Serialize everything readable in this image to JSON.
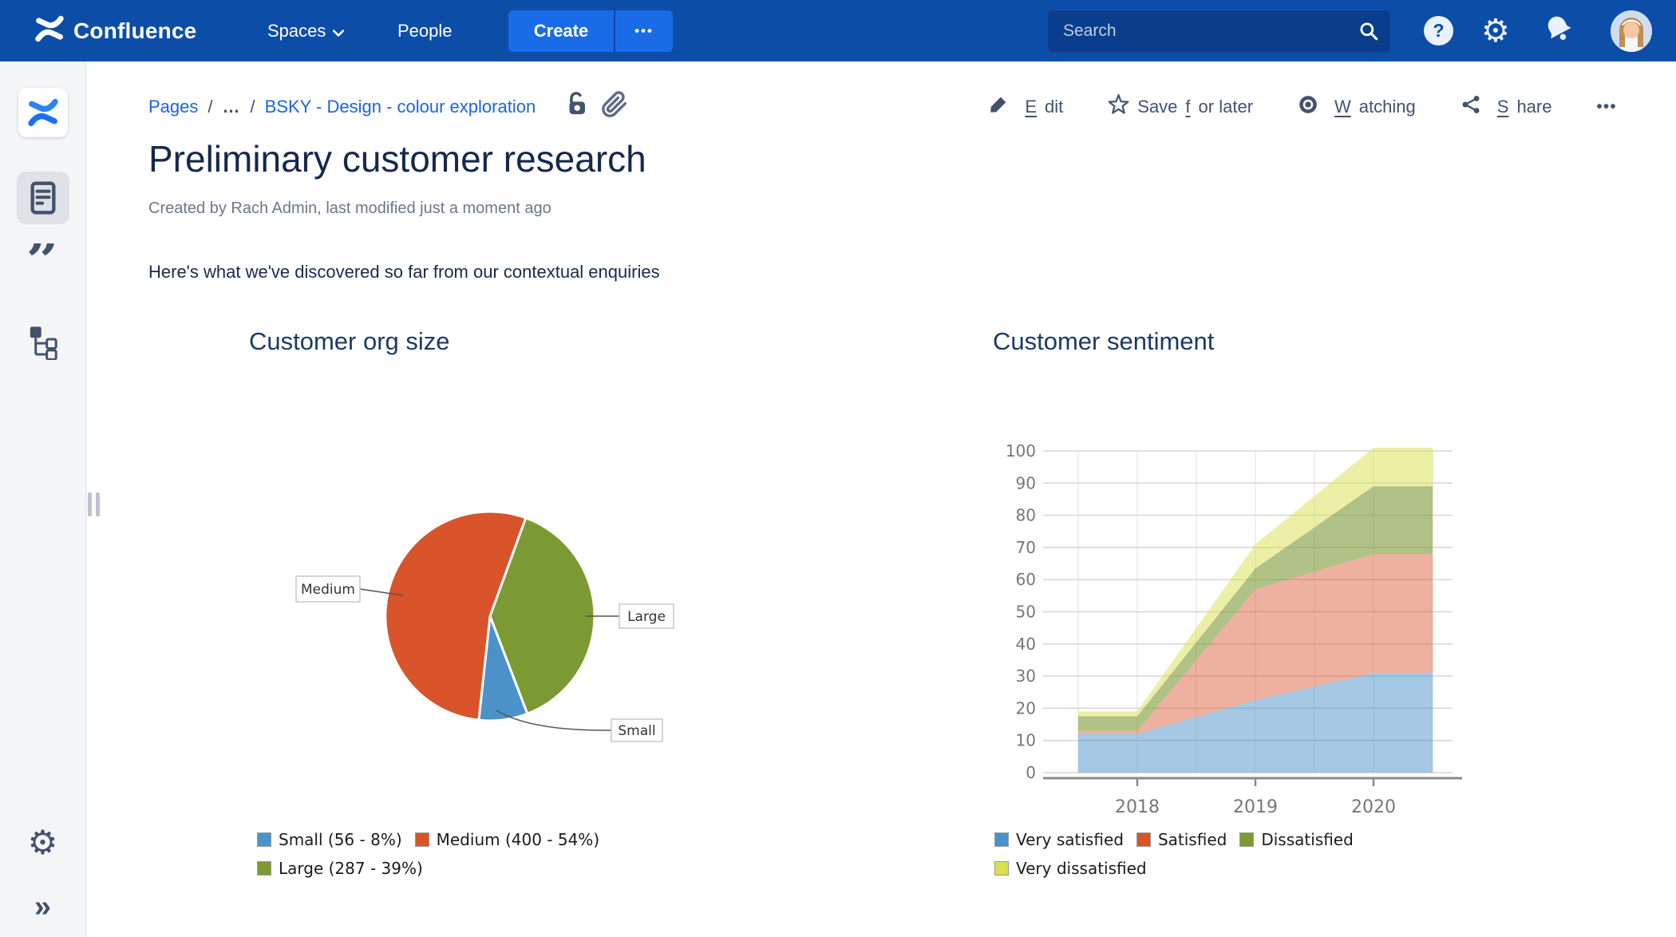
{
  "topnav": {
    "brand": "Confluence",
    "spaces_label": "Spaces",
    "people_label": "People",
    "create_label": "Create",
    "create_more_label": "•••",
    "search_placeholder": "Search"
  },
  "sidebar": {
    "expand_glyph": "»"
  },
  "breadcrumb": {
    "item1": "Pages",
    "sep1": "/",
    "ellipsis": "…",
    "sep2": "/",
    "item2": "BSKY - Design - colour exploration"
  },
  "actions": {
    "edit": {
      "pre": "",
      "key": "E",
      "rest": "dit"
    },
    "save": {
      "pre": "Save ",
      "key": "f",
      "rest": "or later"
    },
    "watch": {
      "pre": "",
      "key": "W",
      "rest": "atching"
    },
    "share": {
      "pre": "",
      "key": "S",
      "rest": "hare"
    },
    "more": "•••"
  },
  "page": {
    "title": "Preliminary customer research",
    "byline": "Created by Rach Admin, last modified just a moment ago",
    "intro": "Here's what we've discovered so far from our contextual enquiries"
  },
  "chart_data": [
    {
      "type": "pie",
      "title": "Customer org size",
      "slices": [
        {
          "label": "Small",
          "value": 56,
          "pct": 8,
          "color": "#4B92C9"
        },
        {
          "label": "Medium",
          "value": 400,
          "pct": 54,
          "color": "#D9532B"
        },
        {
          "label": "Large",
          "value": 287,
          "pct": 39,
          "color": "#7B9A34"
        }
      ],
      "start_angle_deg": 20,
      "draw_order": [
        "Large",
        "Small",
        "Medium"
      ],
      "callout_labels": [
        "Medium",
        "Large",
        "Small"
      ],
      "legend": [
        {
          "label": "Small (56 - 8%)",
          "color": "#4B92C9"
        },
        {
          "label": "Medium (400 - 54%)",
          "color": "#D9532B"
        },
        {
          "label": "Large (287 - 39%)",
          "color": "#7B9A34"
        }
      ]
    },
    {
      "type": "area",
      "title": "Customer sentiment",
      "stacked": true,
      "x": [
        2017.5,
        2018,
        2019,
        2020,
        2020.5
      ],
      "series": [
        {
          "name": "Very satisfied",
          "color": "#4B92C9",
          "fill_opacity": 0.5,
          "values": [
            12,
            12,
            22.5,
            31,
            31
          ]
        },
        {
          "name": "Satisfied",
          "color": "#D9532B",
          "fill_opacity": 0.45,
          "values": [
            1,
            1,
            34.5,
            37,
            37
          ]
        },
        {
          "name": "Dissatisfied",
          "color": "#7B9A34",
          "fill_opacity": 0.6,
          "values": [
            4.5,
            4.5,
            6.5,
            21,
            21
          ]
        },
        {
          "name": "Very dissatisfied",
          "color": "#D9DF4D",
          "fill_opacity": 0.5,
          "values": [
            1.5,
            1.5,
            7.5,
            12,
            12
          ]
        }
      ],
      "ylim": [
        0,
        100
      ],
      "ytick_step": 10,
      "xticks": [
        2018,
        2019,
        2020
      ],
      "grid": true,
      "legend_position": "bottom",
      "legend": [
        {
          "label": "Very satisfied",
          "color": "#4B92C9"
        },
        {
          "label": "Satisfied",
          "color": "#D9532B"
        },
        {
          "label": "Dissatisfied",
          "color": "#7B9A34"
        },
        {
          "label": "Very dissatisfied",
          "color": "#D9DF4D"
        }
      ]
    }
  ]
}
